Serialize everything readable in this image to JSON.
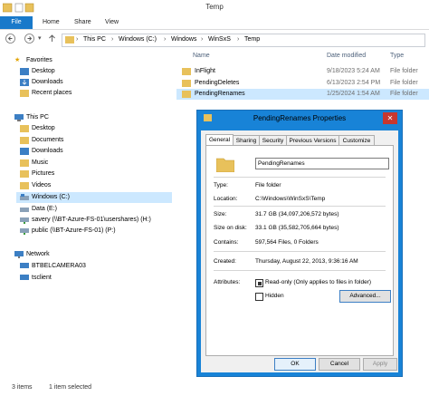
{
  "window": {
    "title": "Temp"
  },
  "ribbon": {
    "file": "File",
    "home": "Home",
    "share": "Share",
    "view": "View"
  },
  "address": {
    "crumbs": [
      "This PC",
      "Windows (C:)",
      "Windows",
      "WinSxS",
      "Temp"
    ]
  },
  "nav": {
    "favorites": {
      "label": "Favorites",
      "items": [
        "Desktop",
        "Downloads",
        "Recent places"
      ]
    },
    "thispc": {
      "label": "This PC",
      "items": [
        "Desktop",
        "Documents",
        "Downloads",
        "Music",
        "Pictures",
        "Videos",
        "Windows (C:)",
        "Data (E:)",
        "savery (\\\\BT-Azure-FS-01\\usershares) (H:)",
        "public (\\\\BT-Azure-FS-01) (P:)"
      ]
    },
    "network": {
      "label": "Network",
      "items": [
        "BTBELCAMERA03",
        "tsclient"
      ]
    }
  },
  "list": {
    "columns": {
      "name": "Name",
      "date": "Date modified",
      "type": "Type"
    },
    "rows": [
      {
        "name": "InFlight",
        "date": "9/18/2023 5:24 AM",
        "type": "File folder"
      },
      {
        "name": "PendingDeletes",
        "date": "6/13/2023 2:54 PM",
        "type": "File folder"
      },
      {
        "name": "PendingRenames",
        "date": "1/25/2024 1:54 AM",
        "type": "File folder"
      }
    ]
  },
  "dialog": {
    "title": "PendingRenames Properties",
    "tabs": [
      "General",
      "Sharing",
      "Security",
      "Previous Versions",
      "Customize"
    ],
    "name": "PendingRenames",
    "type_label": "Type:",
    "type_value": "File folder",
    "location_label": "Location:",
    "location_value": "C:\\Windows\\WinSxS\\Temp",
    "size_label": "Size:",
    "size_value": "31.7 GB (34,097,206,572 bytes)",
    "sizeondisk_label": "Size on disk:",
    "sizeondisk_value": "33.1 GB (35,582,705,664 bytes)",
    "contains_label": "Contains:",
    "contains_value": "597,564 Files, 0 Folders",
    "created_label": "Created:",
    "created_value": "Thursday, August 22, 2013, 9:36:16 AM",
    "attributes_label": "Attributes:",
    "readonly_label": "Read-only (Only applies to files in folder)",
    "hidden_label": "Hidden",
    "advanced_button": "Advanced...",
    "ok_button": "OK",
    "cancel_button": "Cancel",
    "apply_button": "Apply"
  },
  "status": {
    "items": "3 items",
    "selected": "1 item selected"
  },
  "colors": {
    "accent": "#1979ca",
    "dialog_frame": "#1883d7",
    "selection": "#cce8ff",
    "folder": "#e8c15b"
  }
}
